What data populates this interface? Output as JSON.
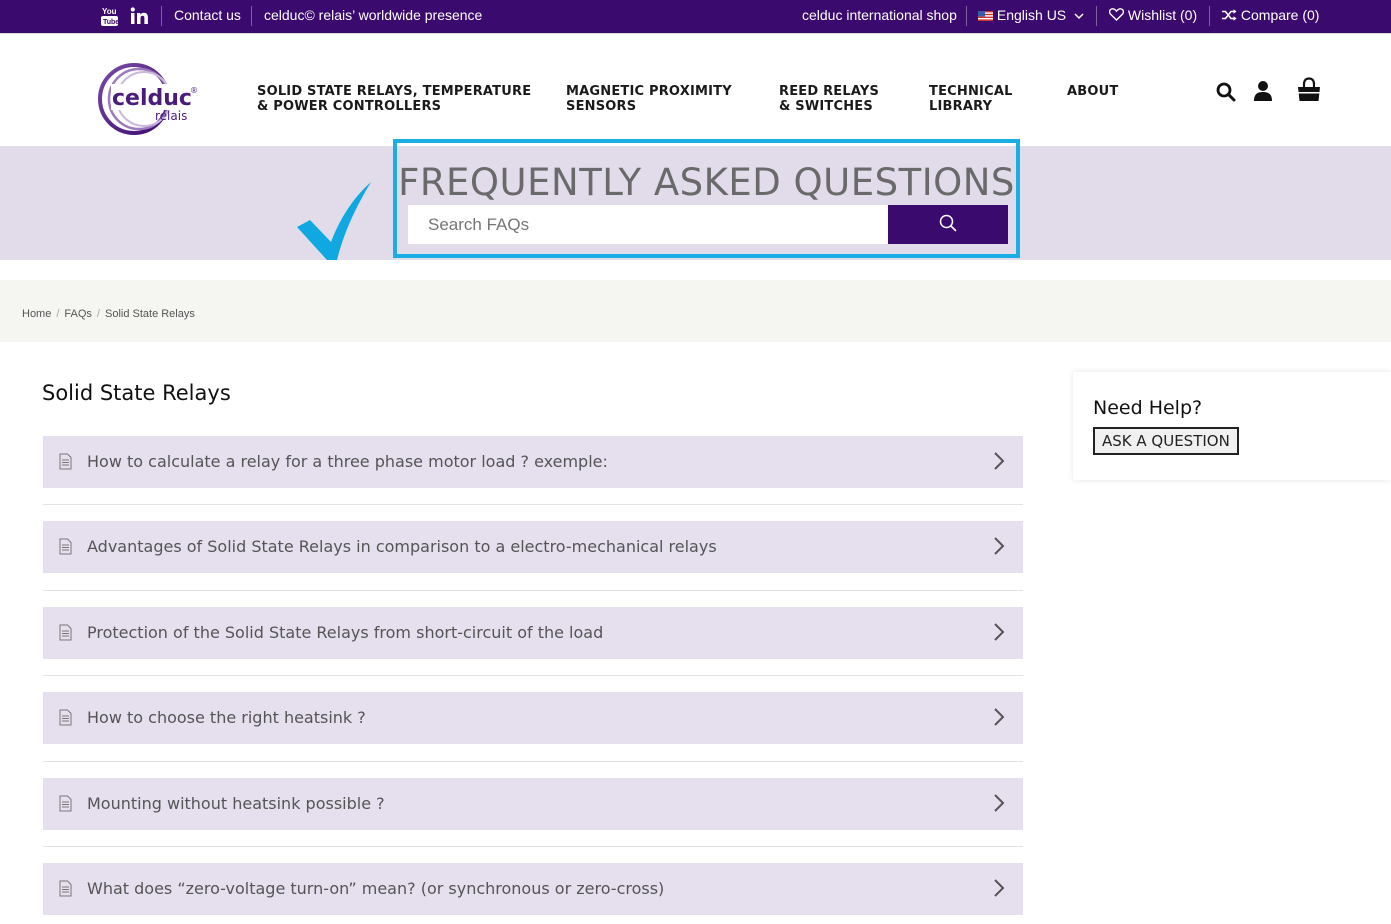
{
  "topbar": {
    "contact": "Contact us",
    "presence": "celduc© relais’ worldwide presence",
    "shop": "celduc international shop",
    "language": "English US",
    "wishlist": "Wishlist (0)",
    "compare": "Compare (0)"
  },
  "logo": {
    "main": "celduc",
    "sub": "relais",
    "reg": "®"
  },
  "nav": [
    {
      "line1": "SOLID STATE RELAYS, TEMPERATURE",
      "line2": "& POWER CONTROLLERS"
    },
    {
      "line1": "MAGNETIC PROXIMITY",
      "line2": "SENSORS"
    },
    {
      "line1": "REED RELAYS",
      "line2": "& SWITCHES"
    },
    {
      "line1": "TECHNICAL",
      "line2": "LIBRARY"
    },
    {
      "line1": "ABOUT",
      "line2": ""
    }
  ],
  "banner": {
    "title": "FREQUENTLY ASKED QUESTIONS",
    "search_placeholder": "Search FAQs"
  },
  "breadcrumb": [
    "Home",
    "FAQs",
    "Solid State Relays"
  ],
  "main": {
    "section_title": "Solid State Relays",
    "faqs": [
      "How to calculate a relay for a three phase motor load ? exemple:",
      "Advantages of Solid State Relays in comparison to a electro-mechanical relays",
      "Protection of the Solid State Relays from short-circuit of the load",
      "How to choose the right heatsink ?",
      "Mounting without heatsink possible ?",
      "What does “zero-voltage turn-on” mean? (or synchronous or zero-cross)"
    ]
  },
  "sidebar": {
    "help_title": "Need Help?",
    "ask_button": "ASK A QUESTION"
  },
  "colors": {
    "brand_purple": "#3b0a6e",
    "banner_bg": "#e2dcea",
    "faq_bg": "#e5dfee",
    "highlight_blue": "#1aaee5"
  }
}
